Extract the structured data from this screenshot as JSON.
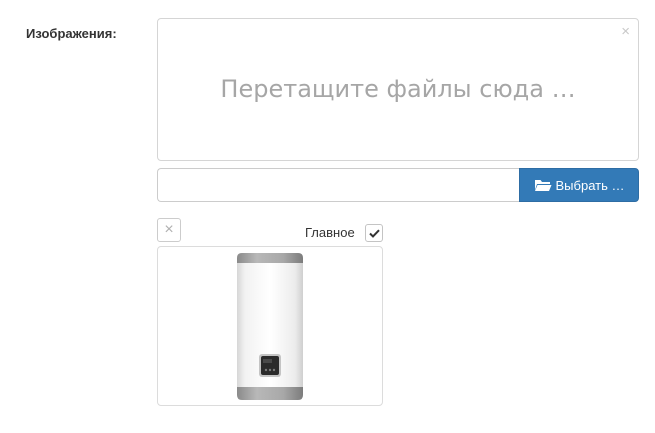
{
  "form": {
    "images_label": "Изображения:"
  },
  "dropzone": {
    "placeholder": "Перетащите файлы сюда …",
    "clear_icon": "close-icon"
  },
  "file_picker": {
    "caption_value": "",
    "browse_label": "Выбрать …",
    "browse_icon": "folder-open-icon"
  },
  "preview": {
    "main_label": "Главное",
    "main_checked": true,
    "remove_icon": "close-icon",
    "image_subject": "water-heater"
  },
  "colors": {
    "primary": "#337ab7",
    "placeholder_text": "#a6a6a6",
    "border": "#cccccc"
  }
}
